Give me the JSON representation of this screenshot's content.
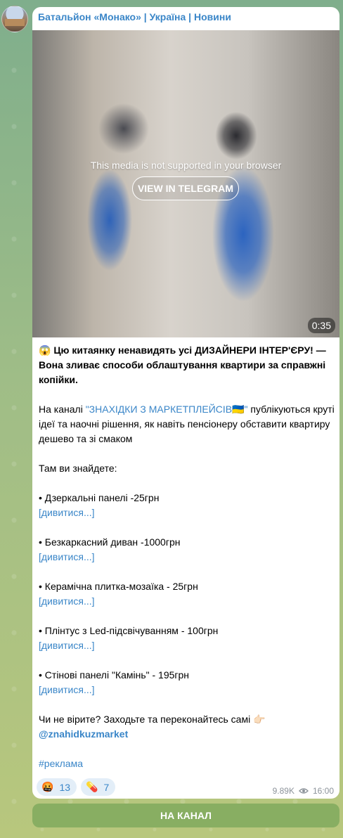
{
  "post": {
    "channel_name": "Батальйон «Монако» | Україна | Новини",
    "media": {
      "unsupported_text": "This media is not supported in your browser",
      "view_button": "VIEW IN TELEGRAM",
      "duration": "0:35"
    },
    "text": {
      "headline_emoji": "😱",
      "headline": "Цю китаянку ненавидять усі ДИЗАЙНЕРИ ІНТЕР'ЄРУ! — Вона зливає способи облаштування квартири за справжні копійки.",
      "intro_prefix": "На каналі ",
      "intro_link": "\"ЗНАХІДКИ З МАРКЕТПЛЕЙСІВ🇺🇦\"",
      "intro_suffix": " публікуються круті ідеї та наочні рішення, як навіть пенсіонеру обставити квартиру дешево та зі смаком",
      "list_title": "Там ви знайдете:",
      "items": [
        {
          "label": "• Дзеркальні панелі -25грн",
          "link": "[дивитися...]"
        },
        {
          "label": "• Безкаркасний диван -1000грн",
          "link": "[дивитися...]"
        },
        {
          "label": "• Керамічна плитка-мозаїка - 25грн",
          "link": "[дивитися...]"
        },
        {
          "label": "• Плінтус з Led-підсвічуванням - 100грн",
          "link": "[дивитися...]"
        },
        {
          "label": "• Стінові панелі \"Камінь\" - 195грн",
          "link": "[дивитися...]"
        }
      ],
      "cta": "Чи не вірите? Заходьте та переконайтесь самі 👉🏻",
      "handle": "@znahidkuzmarket",
      "hashtag": "#реклама"
    },
    "reactions": [
      {
        "emoji": "🤬",
        "count": "13"
      },
      {
        "emoji": "💊",
        "count": "7"
      }
    ],
    "views": "9.89K",
    "time": "16:00",
    "channel_button": "НА КАНАЛ"
  },
  "colors": {
    "link": "#3a86c8",
    "background_top": "#7fae8c",
    "background_bottom": "#b8c77d",
    "button": "#78a55a"
  },
  "icons": {
    "views": "eye-icon"
  }
}
